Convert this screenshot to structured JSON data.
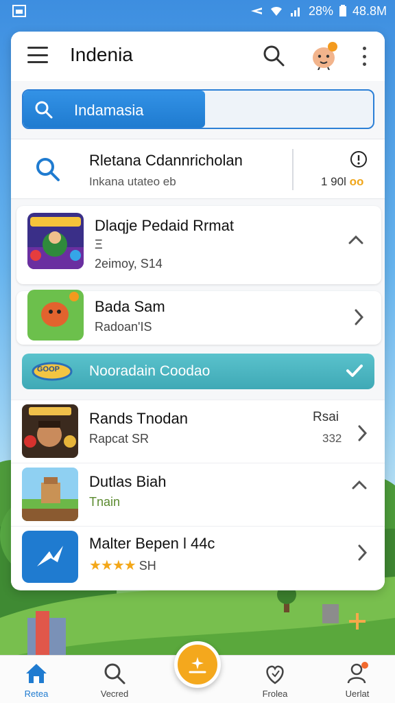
{
  "status_bar": {
    "battery": "28%",
    "time": "48.8M"
  },
  "app_bar": {
    "title": "Indenia"
  },
  "search": {
    "query": "Indamasia",
    "progress": 0.52
  },
  "top_result": {
    "title": "Rletana Cdannricholan",
    "subtitle": "Inkana utateo eb",
    "value": "1 90l",
    "value_accent": "oo"
  },
  "items": [
    {
      "title": "Dlaqje Pedaid Rrmat",
      "meta": "Ξ",
      "subtitle": "2eimoy, S14"
    },
    {
      "title": "Bada Sam",
      "subtitle": "Radoan'IS"
    }
  ],
  "section": {
    "badge": "GOOP",
    "title": "Nooradain Coodao"
  },
  "list": [
    {
      "title": "Rands Tnodan",
      "subtitle": "Rapcat SR",
      "right_top": "Rsai",
      "right_bottom": "332"
    },
    {
      "title": "Dutlas Biah",
      "subtitle": "Tnain"
    },
    {
      "title": "Malter Bepen l 44c",
      "rating": "★★★★",
      "subtitle": "SH"
    }
  ],
  "bottom_nav": [
    {
      "label": "Retea"
    },
    {
      "label": "Vecred"
    },
    {
      "label": "Frolea"
    },
    {
      "label": "Uerlat"
    }
  ],
  "colors": {
    "primary": "#1f7bd0",
    "accent": "#f4a81d",
    "section": "#4db6c0"
  }
}
